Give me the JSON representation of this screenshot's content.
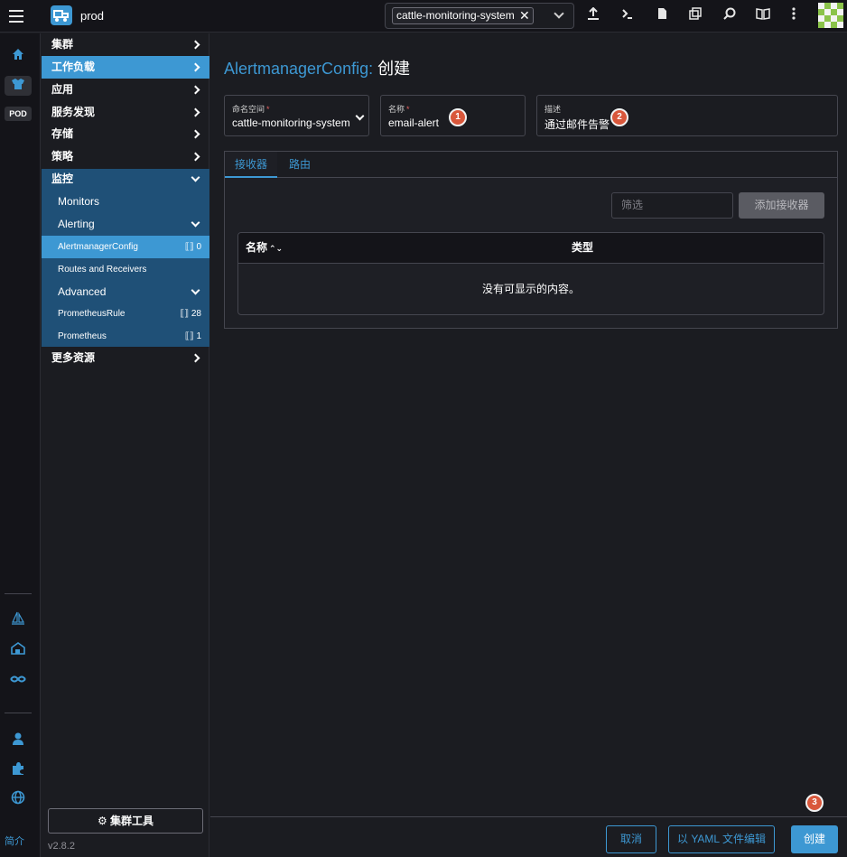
{
  "topbar": {
    "cluster_name": "prod",
    "namespace_chip": "cattle-monitoring-system",
    "chip_close": "✕",
    "icons": [
      "import-yaml-icon",
      "kubectl-shell-icon",
      "kubeconfig-download-icon",
      "copy-kubeconfig-icon",
      "search-icon",
      "docs-icon",
      "more-options-icon"
    ]
  },
  "rail": {
    "pod_label": "POD",
    "about_label": "简介"
  },
  "nav": {
    "items": [
      {
        "label": "集群"
      },
      {
        "label": "工作负载"
      },
      {
        "label": "应用"
      },
      {
        "label": "服务发现"
      },
      {
        "label": "存储"
      },
      {
        "label": "策略"
      },
      {
        "label": "监控"
      },
      {
        "label": "更多资源"
      }
    ],
    "monitoring": {
      "monitors": "Monitors",
      "alerting": "Alerting",
      "alertmanager_config": "AlertmanagerConfig",
      "alertmanager_config_count": "0",
      "routes_receivers": "Routes and Receivers",
      "advanced": "Advanced",
      "prometheus_rule": "PrometheusRule",
      "prometheus_rule_count": "28",
      "prometheus": "Prometheus",
      "prometheus_count": "1"
    },
    "cluster_tools": "集群工具",
    "version": "v2.8.2"
  },
  "main": {
    "title_resource": "AlertmanagerConfig:",
    "title_action": "创建",
    "namespace_label": "命名空间",
    "namespace_value": "cattle-monitoring-system",
    "name_label": "名称",
    "name_value": "email-alert",
    "desc_label": "描述",
    "desc_value": "通过邮件告警",
    "badges": [
      "1",
      "2",
      "3"
    ],
    "tabs": [
      {
        "label": "接收器"
      },
      {
        "label": "路由"
      }
    ],
    "filter_placeholder": "筛选",
    "add_receiver": "添加接收器",
    "table": {
      "col_name": "名称",
      "col_type": "类型",
      "empty_text": "没有可显示的内容。"
    },
    "footer": {
      "cancel": "取消",
      "edit_yaml": "以 YAML 文件编辑",
      "create": "创建"
    }
  }
}
